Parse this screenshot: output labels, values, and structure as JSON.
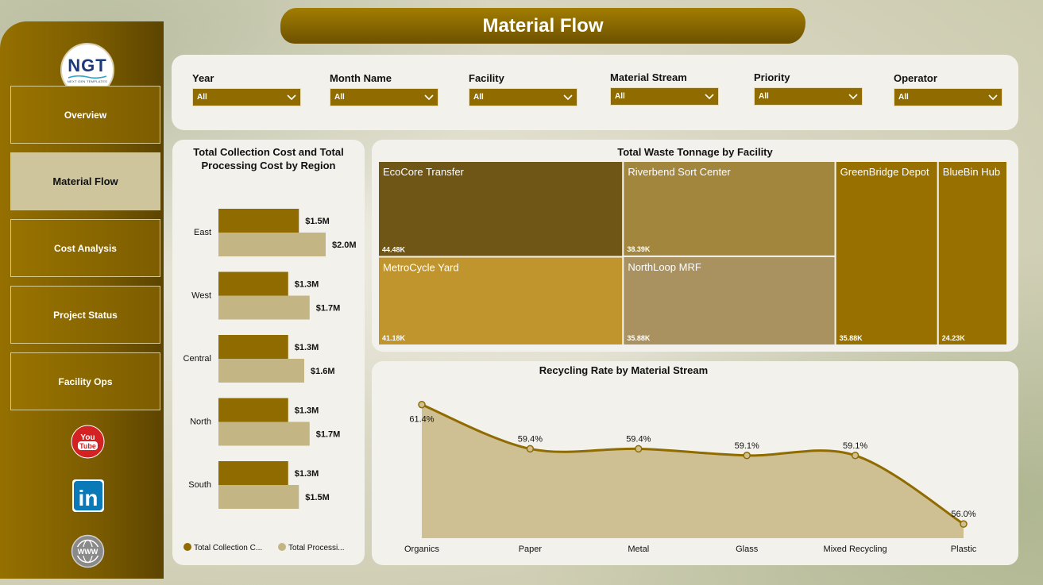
{
  "header": {
    "title": "Material Flow"
  },
  "logo": {
    "main": "NGT",
    "sub": "NEXT GEN TEMPLATES"
  },
  "nav": [
    {
      "label": "Overview",
      "active": false
    },
    {
      "label": "Material Flow",
      "active": true
    },
    {
      "label": "Cost Analysis",
      "active": false
    },
    {
      "label": "Project Status",
      "active": false
    },
    {
      "label": "Facility Ops",
      "active": false
    }
  ],
  "social": {
    "youtube": "You Tube",
    "linkedin": "in",
    "web": "WWW"
  },
  "filters": [
    {
      "label": "Year",
      "value": "All"
    },
    {
      "label": "Month Name",
      "value": "All"
    },
    {
      "label": "Facility",
      "value": "All"
    },
    {
      "label": "Material Stream",
      "value": "All"
    },
    {
      "label": "Priority",
      "value": "All"
    },
    {
      "label": "Operator",
      "value": "All"
    }
  ],
  "colors": {
    "gold": "#8f6b00",
    "tan": "#c4b585",
    "darkgold": "#6f5516",
    "mustard": "#c0952e",
    "olive": "#a3863e",
    "panel": "#f2f1ec"
  },
  "chart_data": [
    {
      "type": "bar",
      "orientation": "horizontal",
      "title": "Total Collection Cost and Total Processing Cost by Region",
      "categories": [
        "East",
        "West",
        "Central",
        "North",
        "South"
      ],
      "series": [
        {
          "name": "Total Collection C...",
          "values": [
            1.5,
            1.3,
            1.3,
            1.3,
            1.3
          ],
          "labels": [
            "$1.5M",
            "$1.3M",
            "$1.3M",
            "$1.3M",
            "$1.3M"
          ],
          "color": "#8f6b00"
        },
        {
          "name": "Total Processi...",
          "values": [
            2.0,
            1.7,
            1.6,
            1.7,
            1.5
          ],
          "labels": [
            "$2.0M",
            "$1.7M",
            "$1.6M",
            "$1.7M",
            "$1.5M"
          ],
          "color": "#c4b585"
        }
      ],
      "xlim": [
        0,
        2.7
      ],
      "legend": "bottom"
    },
    {
      "type": "treemap",
      "title": "Total Waste Tonnage by Facility",
      "items": [
        {
          "name": "EcoCore Transfer",
          "value": 44.48,
          "label": "44.48K",
          "color": "#6f5516"
        },
        {
          "name": "Riverbend Sort Center",
          "value": 38.39,
          "label": "38.39K",
          "color": "#a3863e"
        },
        {
          "name": "GreenBridge Depot",
          "value": 35.88,
          "label": "35.88K",
          "color": "#987000"
        },
        {
          "name": "BlueBin Hub",
          "value": 24.23,
          "label": "24.23K",
          "color": "#987000"
        },
        {
          "name": "MetroCycle Yard",
          "value": 41.18,
          "label": "41.18K",
          "color": "#c0952e"
        },
        {
          "name": "NorthLoop MRF",
          "value": 35.88,
          "label": "35.88K",
          "color": "#aa9160"
        }
      ]
    },
    {
      "type": "area",
      "title": "Recycling Rate by Material Stream",
      "categories": [
        "Organics",
        "Paper",
        "Metal",
        "Glass",
        "Mixed Recycling",
        "Plastic"
      ],
      "values": [
        61.4,
        59.4,
        59.4,
        59.1,
        59.1,
        56.0
      ],
      "labels": [
        "61.4%",
        "59.4%",
        "59.4%",
        "59.1%",
        "59.1%",
        "56.0%"
      ],
      "ylim": [
        55,
        62
      ],
      "line_color": "#8f6b00",
      "fill_color": "#cfc093"
    }
  ]
}
